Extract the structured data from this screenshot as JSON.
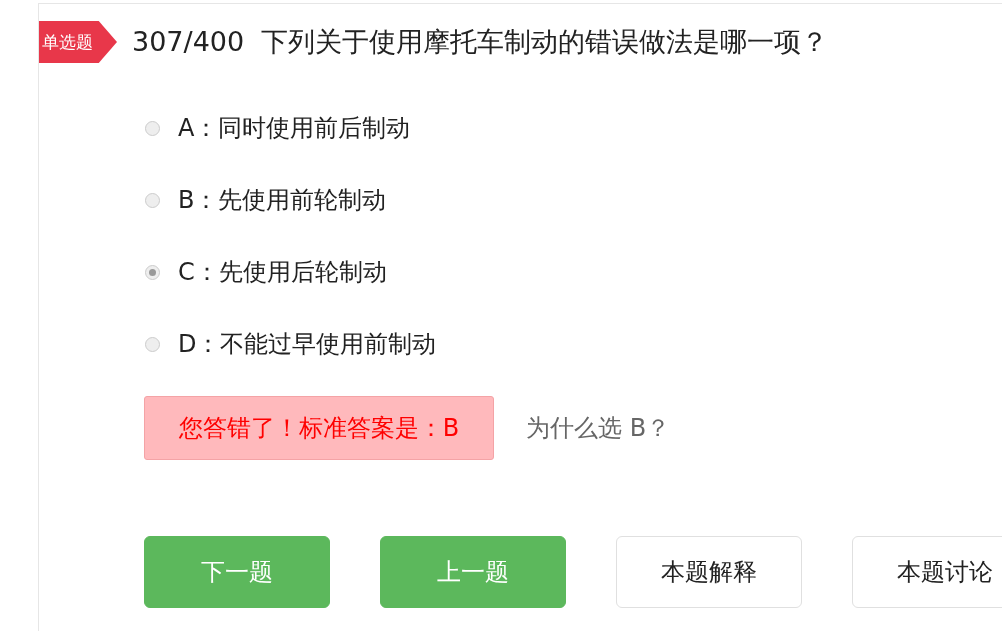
{
  "question": {
    "type_label": "单选题",
    "number": "307/400",
    "text": "下列关于使用摩托车制动的错误做法是哪一项？"
  },
  "options": [
    {
      "text": "A：同时使用前后制动",
      "selected": false
    },
    {
      "text": "B：先使用前轮制动",
      "selected": false
    },
    {
      "text": "C：先使用后轮制动",
      "selected": true
    },
    {
      "text": "D：不能过早使用前制动",
      "selected": false
    }
  ],
  "feedback": {
    "message": "您答错了！标准答案是：B",
    "why_link": "为什么选 B？"
  },
  "buttons": [
    {
      "label": "下一题",
      "kind": "primary"
    },
    {
      "label": "上一题",
      "kind": "primary"
    },
    {
      "label": "本题解释",
      "kind": "secondary"
    },
    {
      "label": "本题讨论",
      "kind": "secondary"
    }
  ]
}
